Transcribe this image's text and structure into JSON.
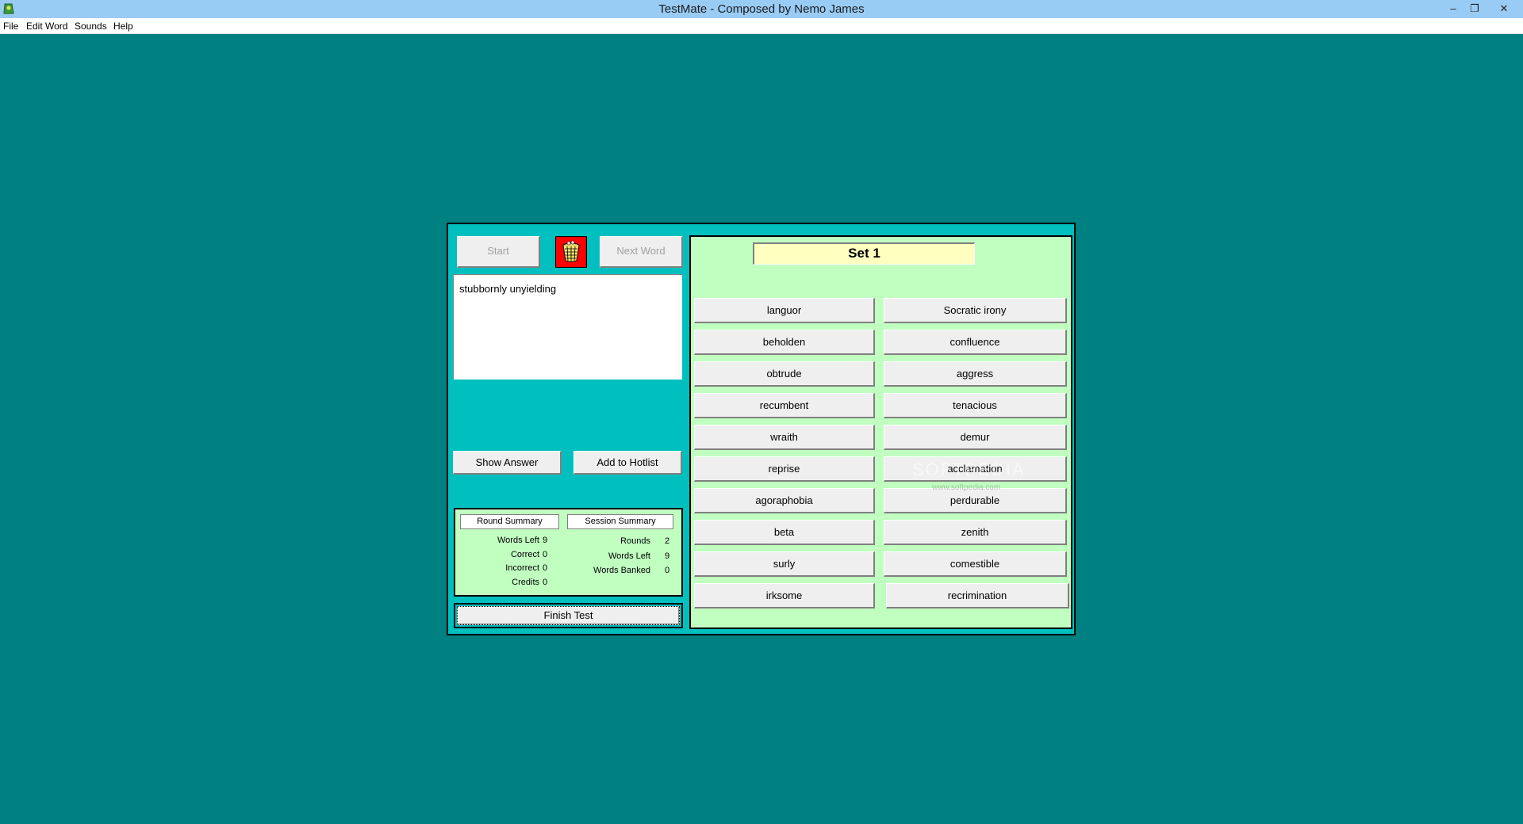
{
  "window": {
    "title": "TestMate - Composed by Nemo James",
    "controls": {
      "minimize": "–",
      "maximize": "❐",
      "close": "✕"
    }
  },
  "menu": [
    "File",
    "Edit Word",
    "Sounds",
    "Help"
  ],
  "toolbar": {
    "start_label": "Start",
    "next_word_label": "Next Word",
    "basket_icon": "wastebasket-icon"
  },
  "question": {
    "text": "stubbornly unyielding"
  },
  "actions": {
    "show_answer_label": "Show Answer",
    "add_hotlist_label": "Add to  Hotlist"
  },
  "round_summary": {
    "tab_label": "Round Summary",
    "words_left_label": "Words Left",
    "words_left": "9",
    "correct_label": "Correct",
    "correct": "0",
    "incorrect_label": "Incorrect",
    "incorrect": "0",
    "credits_label": "Credits",
    "credits": "0"
  },
  "session_summary": {
    "tab_label": "Session Summary",
    "rounds_label": "Rounds",
    "rounds": "2",
    "words_left_label": "Words Left",
    "words_left": "9",
    "words_banked_label": "Words Banked",
    "words_banked": "0"
  },
  "finish_label": "Finish Test",
  "set": {
    "title": "Set 1",
    "left_words": [
      "languor",
      "beholden",
      "obtrude",
      "recumbent",
      "wraith",
      "reprise",
      "agoraphobia",
      "beta",
      "surly",
      "irksome"
    ],
    "right_words": [
      "Socratic irony",
      "confluence",
      "aggress",
      "tenacious",
      "demur",
      "acclamation",
      "perdurable",
      "zenith",
      "comestible",
      "recrimination"
    ]
  },
  "watermark": {
    "text": "SOFTPEDIA",
    "sub": "www.softpedia.com"
  },
  "colors": {
    "desktop": "#008080",
    "dialog": "#00bfbf",
    "panel": "#c0ffc0",
    "set_title_bg": "#ffffc0",
    "basket_bg": "#ff0000"
  }
}
